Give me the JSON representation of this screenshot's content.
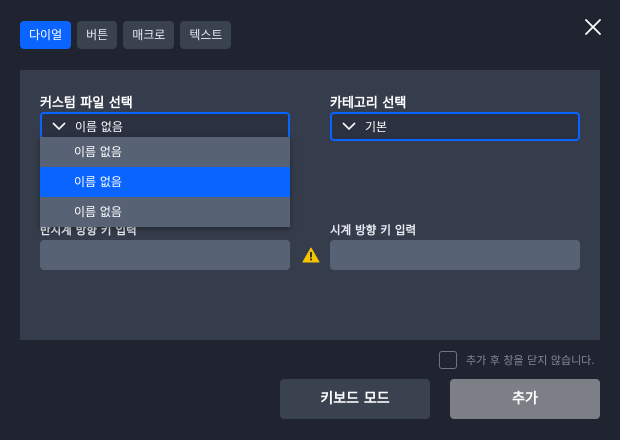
{
  "tabs": [
    {
      "label": "다이얼",
      "active": true
    },
    {
      "label": "버튼",
      "active": false
    },
    {
      "label": "매크로",
      "active": false
    },
    {
      "label": "텍스트",
      "active": false
    }
  ],
  "custom_file": {
    "label": "커스텀 파일 선택",
    "selected": "이름 없음",
    "options": [
      "이름 없음",
      "이름 없음",
      "이름 없음"
    ],
    "highlighted_index": 1
  },
  "category": {
    "label": "카테고리 선택",
    "selected": "기본"
  },
  "counterclockwise": {
    "label": "반시계 방향 키 입력",
    "value": ""
  },
  "clockwise": {
    "label": "시계 방향 키 입력",
    "value": ""
  },
  "warning_icon": "warning-triangle-icon",
  "keep_open": {
    "label": "추가 후 창을 닫지 않습니다.",
    "checked": false
  },
  "buttons": {
    "keyboard_mode": "키보드 모드",
    "add": "추가"
  },
  "colors": {
    "background": "#1f2430",
    "panel": "#353c4b",
    "accent": "#0a64ff",
    "input": "#586275",
    "add_button": "#7c7f86",
    "warning": "#f5c400"
  }
}
